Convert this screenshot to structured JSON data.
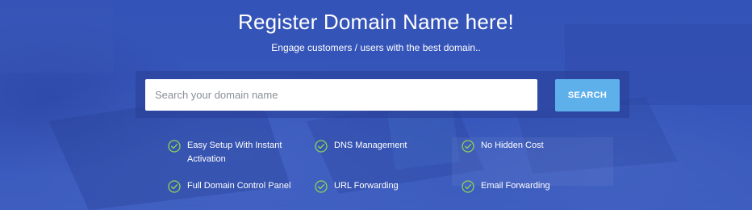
{
  "hero": {
    "title": "Register Domain Name here!",
    "subtitle": "Engage customers / users with the best domain.."
  },
  "search": {
    "placeholder": "Search your domain name",
    "button_label": "SEARCH"
  },
  "features": [
    {
      "label": "Easy Setup With Instant Activation",
      "icon": "check-circle-icon"
    },
    {
      "label": "DNS Management",
      "icon": "check-circle-icon"
    },
    {
      "label": "No Hidden Cost",
      "icon": "check-circle-icon"
    },
    {
      "label": "Full Domain Control Panel",
      "icon": "check-circle-icon"
    },
    {
      "label": "URL Forwarding",
      "icon": "check-circle-icon"
    },
    {
      "label": "Email Forwarding",
      "icon": "check-circle-icon"
    }
  ],
  "colors": {
    "overlay": "#3454BA",
    "button": "#5EB0EA",
    "check": "#8BD35A",
    "text": "#FFFFFF"
  }
}
